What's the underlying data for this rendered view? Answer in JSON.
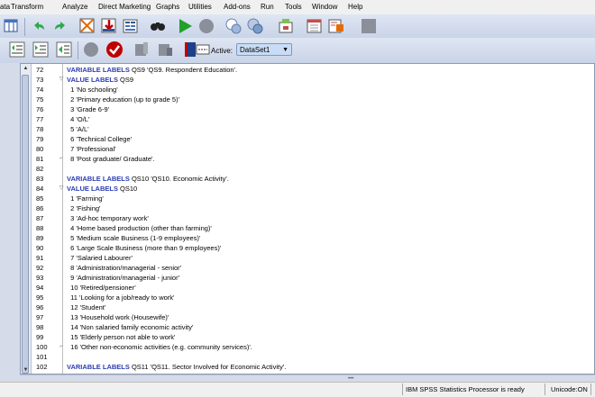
{
  "menu": [
    "ata",
    "Transform",
    "Analyze",
    "Direct Marketing",
    "Graphs",
    "Utilities",
    "Add-ons",
    "Run",
    "Tools",
    "Window",
    "Help"
  ],
  "toolbar": {
    "icons_row1": [
      "data-editor-icon",
      "undo-icon",
      "redo-icon",
      "goto-case-icon",
      "insert-variable-icon",
      "split-file-icon",
      "find-icon",
      "run-icon",
      "stop-icon",
      "syntax-help-icon",
      "variables-icon",
      "designate-window-icon",
      "spreadsheet-icon",
      "output-icon",
      "gray-box-icon"
    ],
    "icons_row2": [
      "indent-left-icon",
      "indent-right-icon",
      "comment-icon",
      "breakpoint-icon",
      "validate-icon",
      "bookmark-icon",
      "next-bookmark-icon",
      "book-icon"
    ],
    "active_label": "Active:",
    "dataset_value": "DataSet1"
  },
  "lines": [
    {
      "n": "72",
      "kw": "VARIABLE LABELS",
      "text": " QS9 'QS9. Respondent Education'.",
      "fold": ""
    },
    {
      "n": "73",
      "kw": "VALUE LABELS",
      "text": " QS9",
      "fold": "▽"
    },
    {
      "n": "74",
      "kw": "",
      "text": "  1 'No schooling'",
      "fold": ""
    },
    {
      "n": "75",
      "kw": "",
      "text": "  2 'Primary education (up to grade 5)'",
      "fold": ""
    },
    {
      "n": "76",
      "kw": "",
      "text": "  3 'Grade 6-9'",
      "fold": ""
    },
    {
      "n": "77",
      "kw": "",
      "text": "  4 'O/L'",
      "fold": ""
    },
    {
      "n": "78",
      "kw": "",
      "text": "  5 'A/L'",
      "fold": ""
    },
    {
      "n": "79",
      "kw": "",
      "text": "  6 'Technical College'",
      "fold": ""
    },
    {
      "n": "80",
      "kw": "",
      "text": "  7 'Professional'",
      "fold": ""
    },
    {
      "n": "81",
      "kw": "",
      "text": "  8 'Post graduate/ Graduate'.",
      "fold": "⌐"
    },
    {
      "n": "82",
      "kw": "",
      "text": "",
      "fold": ""
    },
    {
      "n": "83",
      "kw": "VARIABLE LABELS",
      "text": " QS10 'QS10. Economic Activity'.",
      "fold": ""
    },
    {
      "n": "84",
      "kw": "VALUE LABELS",
      "text": " QS10",
      "fold": "▽"
    },
    {
      "n": "85",
      "kw": "",
      "text": "  1 'Farming'",
      "fold": ""
    },
    {
      "n": "86",
      "kw": "",
      "text": "  2 'Fishing'",
      "fold": ""
    },
    {
      "n": "87",
      "kw": "",
      "text": "  3 'Ad-hoc temporary work'",
      "fold": ""
    },
    {
      "n": "88",
      "kw": "",
      "text": "  4 'Home based production (other than farming)'",
      "fold": ""
    },
    {
      "n": "89",
      "kw": "",
      "text": "  5 'Medium scale Business (1-9 employees)'",
      "fold": ""
    },
    {
      "n": "90",
      "kw": "",
      "text": "  6 'Large Scale Business (more than 9 employees)'",
      "fold": ""
    },
    {
      "n": "91",
      "kw": "",
      "text": "  7 'Salaried Labourer'",
      "fold": ""
    },
    {
      "n": "92",
      "kw": "",
      "text": "  8 'Administration/managerial - senior'",
      "fold": ""
    },
    {
      "n": "93",
      "kw": "",
      "text": "  9 'Administration/managerial - junior'",
      "fold": ""
    },
    {
      "n": "94",
      "kw": "",
      "text": "  10 'Retired/pensioner'",
      "fold": ""
    },
    {
      "n": "95",
      "kw": "",
      "text": "  11 'Looking for a job/ready to work'",
      "fold": ""
    },
    {
      "n": "96",
      "kw": "",
      "text": "  12 'Student'",
      "fold": ""
    },
    {
      "n": "97",
      "kw": "",
      "text": "  13 'Household work (Housewife)'",
      "fold": ""
    },
    {
      "n": "98",
      "kw": "",
      "text": "  14 'Non salaried family economic activity'",
      "fold": ""
    },
    {
      "n": "99",
      "kw": "",
      "text": "  15 'Elderly person not able to work'",
      "fold": ""
    },
    {
      "n": "100",
      "kw": "",
      "text": "  16 'Other non-economic activities (e.g. community services)'.",
      "fold": "⌐"
    },
    {
      "n": "101",
      "kw": "",
      "text": "",
      "fold": ""
    },
    {
      "n": "102",
      "kw": "VARIABLE LABELS",
      "text": " QS11 'QS11. Sector Involved for Economic Activity'.",
      "fold": ""
    }
  ],
  "status": {
    "processor": "IBM SPSS Statistics Processor is ready",
    "unicode": "Unicode:ON"
  }
}
